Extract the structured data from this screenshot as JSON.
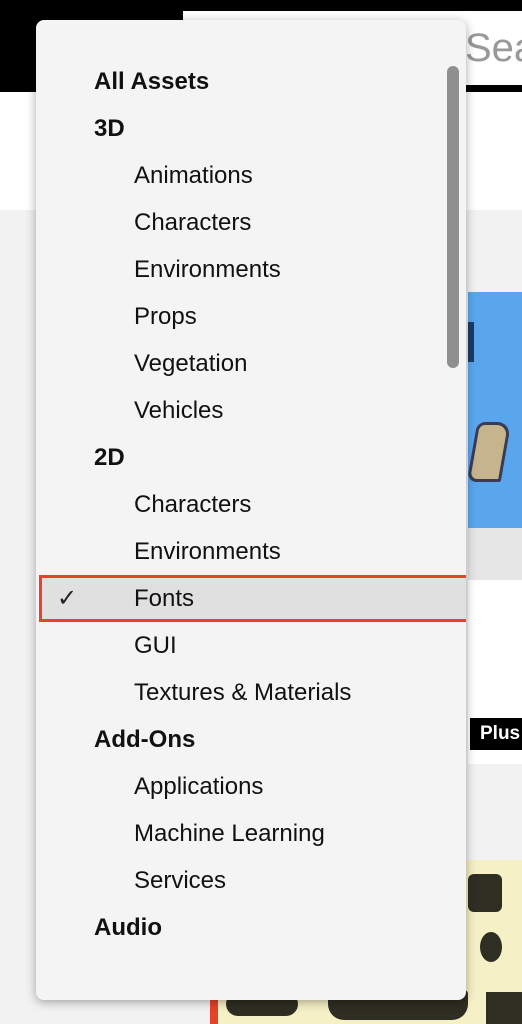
{
  "background": {
    "search_partial_text": "Searc",
    "plus_badge": "Plus"
  },
  "menu": {
    "items": [
      {
        "label": "All Assets",
        "level": "header"
      },
      {
        "label": "3D",
        "level": "header"
      },
      {
        "label": "Animations",
        "level": "child"
      },
      {
        "label": "Characters",
        "level": "child"
      },
      {
        "label": "Environments",
        "level": "child"
      },
      {
        "label": "Props",
        "level": "child"
      },
      {
        "label": "Vegetation",
        "level": "child"
      },
      {
        "label": "Vehicles",
        "level": "child"
      },
      {
        "label": "2D",
        "level": "header"
      },
      {
        "label": "Characters",
        "level": "child"
      },
      {
        "label": "Environments",
        "level": "child"
      },
      {
        "label": "Fonts",
        "level": "child",
        "selected": true
      },
      {
        "label": "GUI",
        "level": "child"
      },
      {
        "label": "Textures & Materials",
        "level": "child"
      },
      {
        "label": "Add-Ons",
        "level": "header"
      },
      {
        "label": "Applications",
        "level": "child"
      },
      {
        "label": "Machine Learning",
        "level": "child"
      },
      {
        "label": "Services",
        "level": "child"
      },
      {
        "label": "Audio",
        "level": "header"
      }
    ],
    "check_glyph": "✓",
    "selection_outline_color": "#e8432a"
  }
}
